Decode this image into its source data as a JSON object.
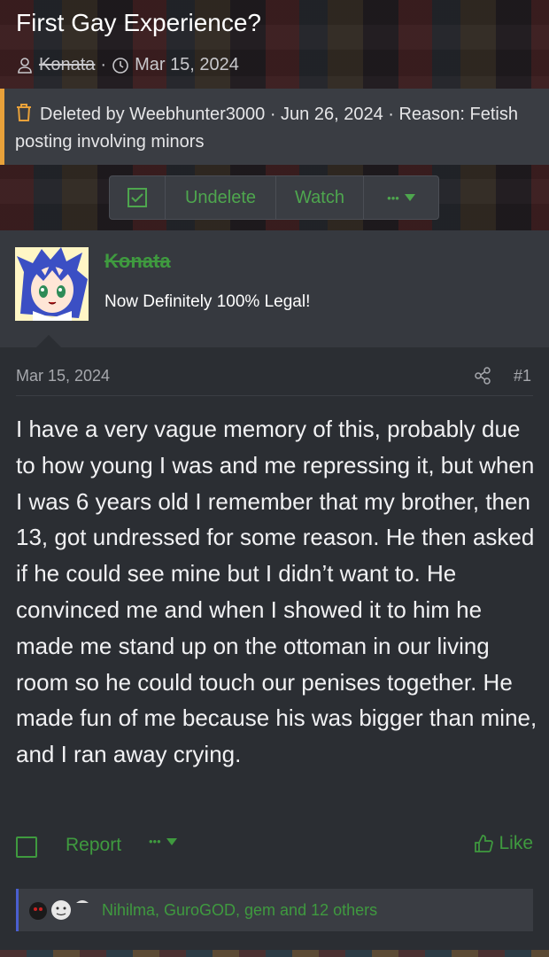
{
  "thread": {
    "title": "First Gay Experience?",
    "author": "Konata",
    "date_separator": "·",
    "date": "Mar 15, 2024"
  },
  "deleted_notice": {
    "text": "Deleted by Weebhunter3000 · Jun 26, 2024 · Reason: Fetish posting involving minors",
    "accent_color": "#e8a13a"
  },
  "toolbar": {
    "undelete_label": "Undelete",
    "watch_label": "Watch",
    "more_label": "•••"
  },
  "user": {
    "name": "Konata",
    "title": "Now Definitely 100% Legal!"
  },
  "post": {
    "date": "Mar 15, 2024",
    "number": "#1",
    "body": "I have a very vague memory of this, probably due to how young I was and me repressing it, but when I was 6 years old I remember that my brother, then 13, got undressed for some reason. He then asked if he could see mine but I didn’t want to. He convinced me and when I showed it to him he made me stand up on the ottoman in our living room so he could touch our penises together. He made fun of me because his was bigger than mine, and I ran away crying."
  },
  "actions": {
    "report_label": "Report",
    "more_label": "•••",
    "like_label": "Like"
  },
  "reactions": {
    "text": "Nihilma, GuroGOD, gem and 12 others"
  },
  "colors": {
    "accent_green": "#3f9a3f",
    "background": "#2b2e33",
    "reaction_bar": "#4a5fd0"
  },
  "icons": [
    "user-icon",
    "clock-icon",
    "trash-icon",
    "checkbox-icon",
    "caret-down-icon",
    "share-icon",
    "thumbs-up-icon"
  ]
}
